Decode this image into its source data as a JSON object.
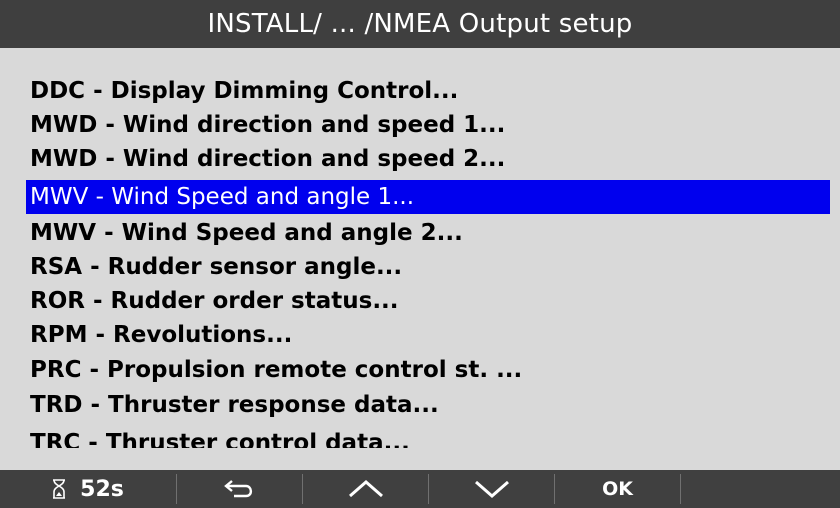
{
  "header": {
    "title": "INSTALL/ ... /NMEA Output setup"
  },
  "menu": {
    "selected_index": 3,
    "items": [
      {
        "label": "DDC - Display Dimming Control..."
      },
      {
        "label": "MWD - Wind direction and speed 1..."
      },
      {
        "label": "MWD - Wind direction and speed 2..."
      },
      {
        "label": "MWV - Wind Speed and angle 1..."
      },
      {
        "label": "MWV - Wind Speed and angle 2..."
      },
      {
        "label": "RSA - Rudder sensor angle..."
      },
      {
        "label": "ROR - Rudder order status..."
      },
      {
        "label": "RPM - Revolutions..."
      },
      {
        "label": "PRC - Propulsion remote control st. ..."
      },
      {
        "label": "TRD - Thruster response data..."
      },
      {
        "label": "TRC - Thruster control data..."
      }
    ]
  },
  "toolbar": {
    "timer_icon": "hourglass-icon",
    "timer_value": "52s",
    "back_icon": "back-arrow-icon",
    "up_icon": "chevron-up-icon",
    "down_icon": "chevron-down-icon",
    "ok_label": "OK"
  },
  "colors": {
    "title_bg": "#3f3f3f",
    "list_bg": "#d9d9d9",
    "selection": "#0000ee",
    "toolbar_bg": "#404040"
  }
}
